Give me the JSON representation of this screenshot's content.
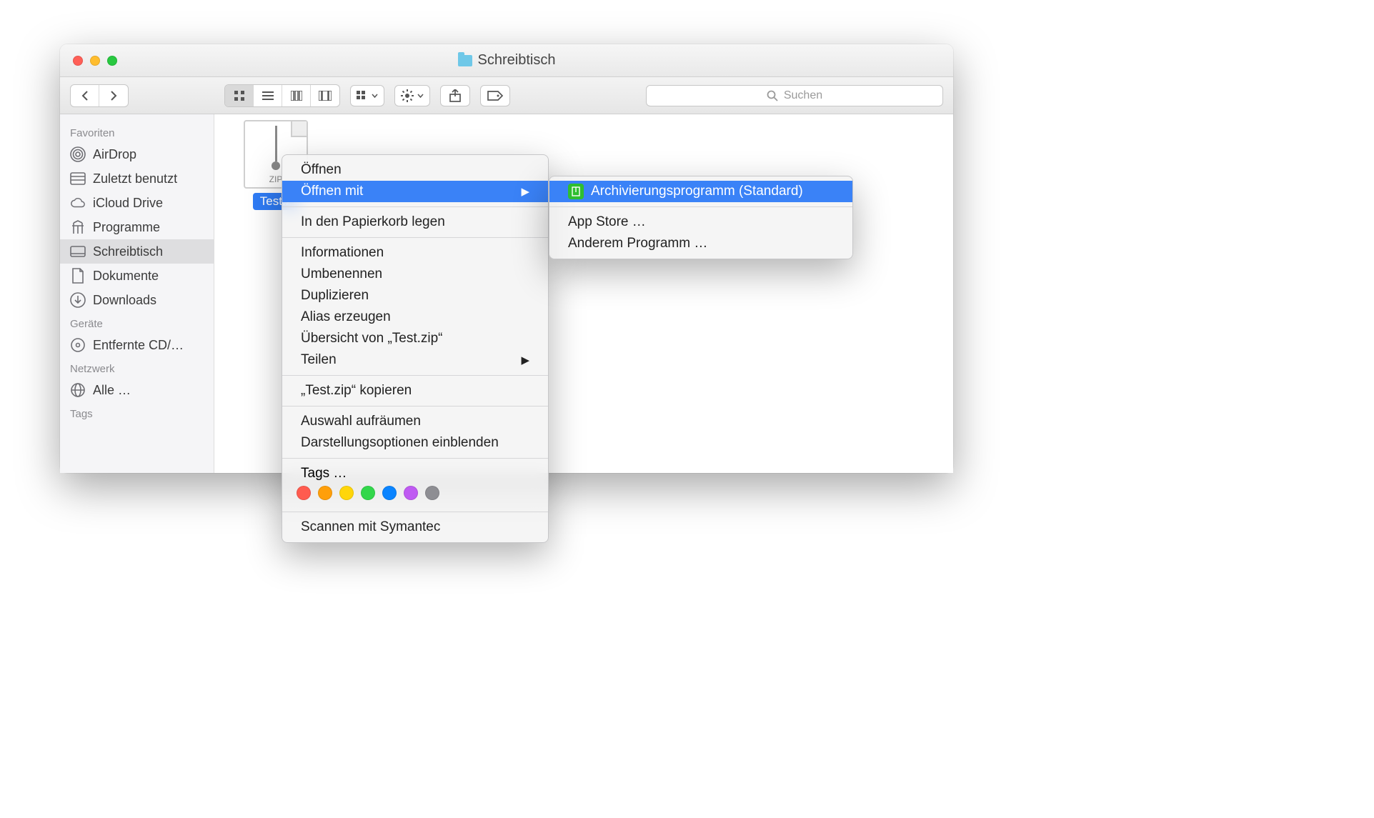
{
  "window": {
    "title": "Schreibtisch"
  },
  "toolbar": {
    "search_placeholder": "Suchen"
  },
  "sidebar": {
    "favorites_header": "Favoriten",
    "items": [
      {
        "label": "AirDrop"
      },
      {
        "label": "Zuletzt benutzt"
      },
      {
        "label": "iCloud Drive"
      },
      {
        "label": "Programme"
      },
      {
        "label": "Schreibtisch"
      },
      {
        "label": "Dokumente"
      },
      {
        "label": "Downloads"
      }
    ],
    "devices_header": "Geräte",
    "devices": [
      {
        "label": "Entfernte CD/…"
      }
    ],
    "network_header": "Netzwerk",
    "network": [
      {
        "label": "Alle …"
      }
    ],
    "tags_header": "Tags"
  },
  "file": {
    "ext_label": "ZIP",
    "name": "Test.z"
  },
  "context_menu": {
    "open": "Öffnen",
    "open_with": "Öffnen mit",
    "trash": "In den Papierkorb legen",
    "info": "Informationen",
    "rename": "Umbenennen",
    "duplicate": "Duplizieren",
    "alias": "Alias erzeugen",
    "quicklook": "Übersicht von „Test.zip“",
    "share": "Teilen",
    "copy": "„Test.zip“ kopieren",
    "cleanup": "Auswahl aufräumen",
    "viewopts": "Darstellungsoptionen einblenden",
    "tags_label": "Tags …",
    "scan": "Scannen mit Symantec"
  },
  "tag_colors": [
    "#ff5b4f",
    "#ff9f0a",
    "#ffd60a",
    "#32d74b",
    "#0a84ff",
    "#bf5af2",
    "#8e8e93"
  ],
  "submenu": {
    "default_app": "Archivierungsprogramm (Standard)",
    "appstore": "App Store …",
    "other": "Anderem Programm …"
  }
}
